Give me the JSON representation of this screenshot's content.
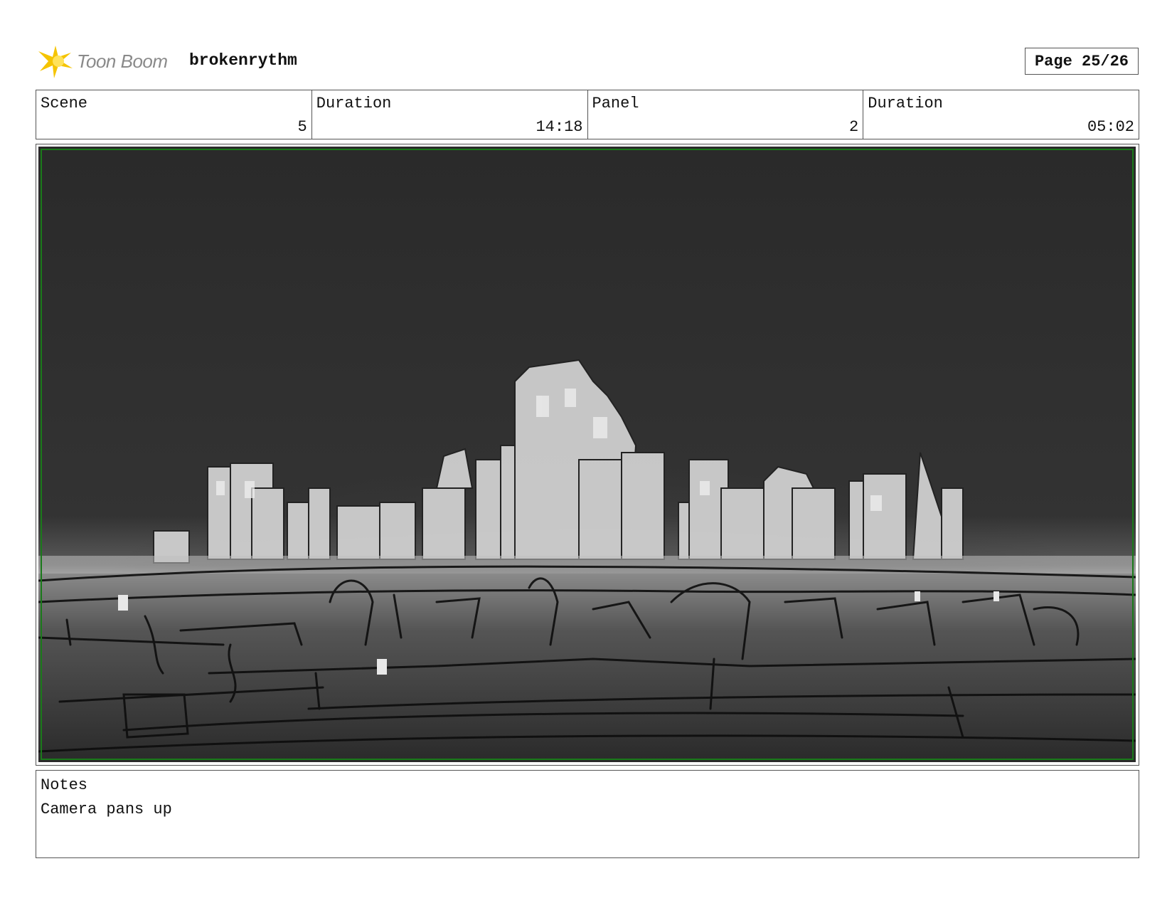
{
  "header": {
    "logo_text": "Toon Boom",
    "project_name": "brokenrythm",
    "page_label": "Page 25/26"
  },
  "info": [
    {
      "label": "Scene",
      "value": "5"
    },
    {
      "label": "Duration",
      "value": "14:18"
    },
    {
      "label": "Panel",
      "value": "2"
    },
    {
      "label": "Duration",
      "value": "05:02"
    }
  ],
  "panel": {
    "image_subject": "city skyline sketch",
    "colors": {
      "sky": "#2f2f2f",
      "buildings": "#d9d9d9",
      "ground": "#4a4a4a",
      "safe_frame": "#1a7a1a"
    }
  },
  "notes": {
    "label": "Notes",
    "text": "Camera pans up"
  }
}
